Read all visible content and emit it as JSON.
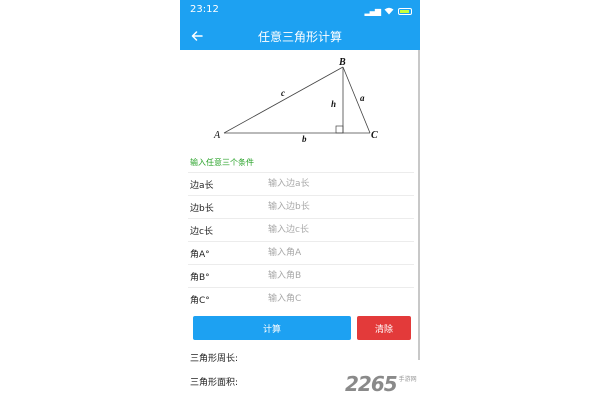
{
  "status_bar": {
    "time": "23:12"
  },
  "app_bar": {
    "title": "任意三角形计算"
  },
  "diagram": {
    "vertex_a": "A",
    "vertex_b": "B",
    "vertex_c": "C",
    "side_a": "a",
    "side_b": "b",
    "side_c": "c",
    "height": "h"
  },
  "hint": "输入任意三个条件",
  "fields": [
    {
      "label": "边a长",
      "placeholder": "输入边a长"
    },
    {
      "label": "边b长",
      "placeholder": "输入边b长"
    },
    {
      "label": "边c长",
      "placeholder": "输入边c长"
    },
    {
      "label": "角A°",
      "placeholder": "输入角A"
    },
    {
      "label": "角B°",
      "placeholder": "输入角B"
    },
    {
      "label": "角C°",
      "placeholder": "输入角C"
    }
  ],
  "buttons": {
    "calculate": "计算",
    "clear": "清除"
  },
  "results": {
    "perimeter_label": "三角形周长:",
    "area_label": "三角形面积:"
  },
  "watermark": {
    "number": "2265",
    "text": "手游网"
  },
  "colors": {
    "primary": "#1da1f2",
    "danger": "#e33a3a",
    "hint": "#29a329"
  }
}
